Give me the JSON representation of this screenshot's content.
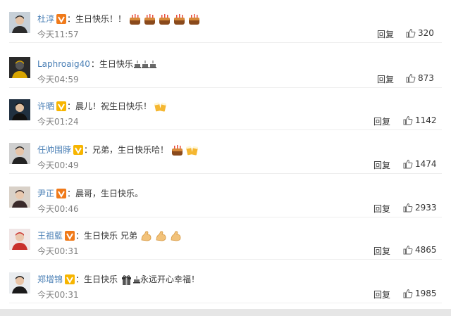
{
  "actions": {
    "reply_label": "回复"
  },
  "comments": [
    {
      "user": "杜淳",
      "verified": true,
      "badge_color": "#f07a1a",
      "text": "生日快乐！！",
      "emojis": [
        "cake-icon",
        "cake-icon",
        "cake-icon",
        "cake-icon",
        "cake-icon"
      ],
      "time": "今天11:57",
      "likes": "320"
    },
    {
      "user": "Laphroaig40",
      "verified": false,
      "text": "生日快乐",
      "emojis": [
        "small-cake-icon",
        "small-cake-icon",
        "small-cake-icon"
      ],
      "time": "今天04:59",
      "likes": "873"
    },
    {
      "user": "许晒",
      "verified": true,
      "badge_color": "#f7b500",
      "text": "晨儿！祝生日快乐！",
      "emojis": [
        "beer-cheers-icon"
      ],
      "time": "今天01:24",
      "likes": "1142"
    },
    {
      "user": "任帅围脖",
      "verified": true,
      "badge_color": "#f7b500",
      "text": "兄弟，生日快乐哈！",
      "emojis": [
        "cake-icon",
        "beer-cheers-icon"
      ],
      "time": "今天00:49",
      "likes": "1474"
    },
    {
      "user": "尹正",
      "verified": true,
      "badge_color": "#f07a1a",
      "text": "晨哥，生日快乐。",
      "emojis": [],
      "time": "今天00:46",
      "likes": "2933"
    },
    {
      "user": "王祖藍",
      "verified": true,
      "badge_color": "#f07a1a",
      "text": "生日快乐 兄弟",
      "emojis": [
        "strong-arm-icon",
        "strong-arm-icon",
        "strong-arm-icon"
      ],
      "time": "今天00:31",
      "likes": "4865"
    },
    {
      "user": "郑增锦",
      "verified": true,
      "badge_color": "#f7b500",
      "text": "生日快乐",
      "text_after": "永远开心幸福！",
      "emojis": [
        "gift-icon",
        "small-cake-icon"
      ],
      "time": "今天00:31",
      "likes": "1985"
    }
  ],
  "colors": {
    "username": "#4a7fb5",
    "time": "#808080",
    "text": "#333333",
    "verified_orange": "#f07a1a",
    "verified_yellow": "#f7b500"
  }
}
